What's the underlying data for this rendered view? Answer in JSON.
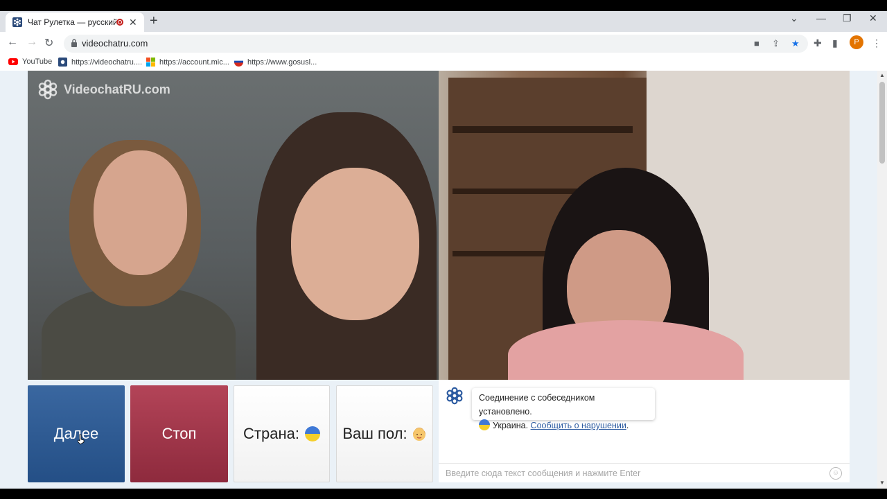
{
  "browser": {
    "tab_title": "Чат Рулетка — русский вид",
    "url": "videochatru.com",
    "bookmarks": [
      {
        "label": "YouTube",
        "icon": "youtube-icon"
      },
      {
        "label": "https://videochatru....",
        "icon": "videochat-icon"
      },
      {
        "label": "https://account.mic...",
        "icon": "microsoft-icon"
      },
      {
        "label": "https://www.gosusl...",
        "icon": "gosuslugi-icon"
      }
    ],
    "profile_initial": "P"
  },
  "logo_text": "VideochatRU.com",
  "controls": {
    "next_label": "Далее",
    "stop_label": "Стоп",
    "country_label": "Страна:",
    "gender_label": "Ваш пол:"
  },
  "chat": {
    "system_message": "Соединение с собеседником установлено.",
    "country": "Украина.",
    "report_link": "Сообщить о нарушении",
    "period": ".",
    "input_placeholder": "Введите сюда текст сообщения и нажмите Enter"
  },
  "colors": {
    "next_button": "#2f5b93",
    "stop_button": "#a23a4e",
    "link": "#2b5aa0",
    "page_bg": "#eaf1f7"
  }
}
